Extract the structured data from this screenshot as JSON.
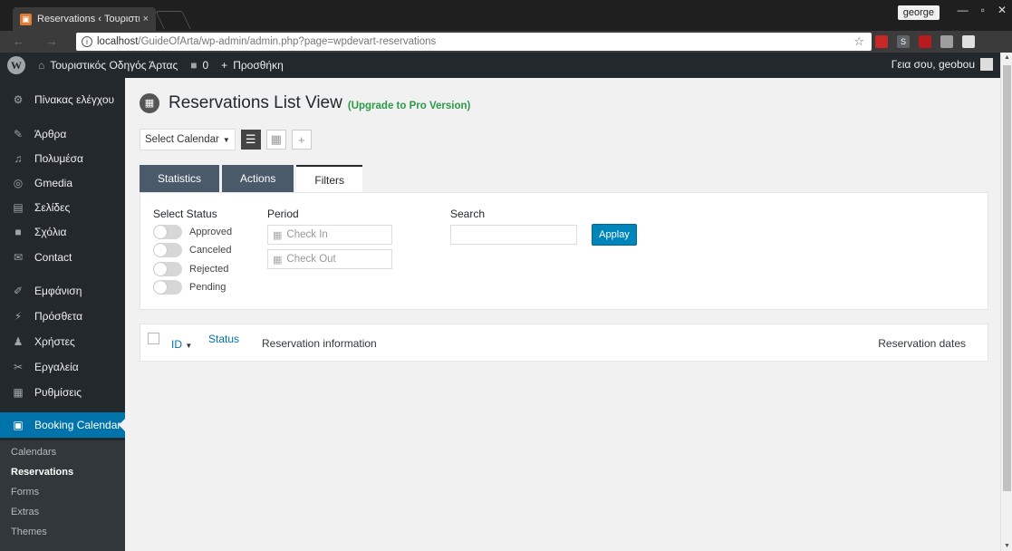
{
  "browser": {
    "tab_title": "Reservations ‹ Τουριστικ",
    "tab_close": "×",
    "profile_name": "george",
    "window_controls": [
      "—",
      "▫",
      "✕"
    ],
    "nav_buttons": "← → C",
    "url_host": "localhost",
    "url_path": "/GuideOfArta/wp-admin/admin.php?page=wpdevart-reservations",
    "info_icon": "i",
    "bookmark_star": "☆",
    "extensions": [
      {
        "name": "ext-red-icon",
        "label": "",
        "color": "#c62828"
      },
      {
        "name": "ext-s-icon",
        "label": "S",
        "color": "#5f6368"
      },
      {
        "name": "ext-ublock-icon",
        "label": "",
        "color": "#b71c1c"
      },
      {
        "name": "ext-puzzle-icon",
        "label": "",
        "color": "#9e9e9e"
      },
      {
        "name": "ext-drive-icon",
        "label": "",
        "color": "#e0e0e0"
      }
    ]
  },
  "adminbar": {
    "wp_logo": "W",
    "site_name": "Τουριστικός Οδηγός Άρτας",
    "comments_count": "0",
    "new_label": "Προσθήκη",
    "greeting": "Γεια σου, geobou"
  },
  "sidebar": {
    "items": [
      {
        "label": "Πίνακας ελέγχου",
        "icon": "dashboard-icon",
        "glyph": "⚙"
      },
      {
        "label": "Άρθρα",
        "icon": "pin-icon",
        "glyph": "✎"
      },
      {
        "label": "Πολυμέσα",
        "icon": "media-icon",
        "glyph": "♫"
      },
      {
        "label": "Gmedia",
        "icon": "gmedia-icon",
        "glyph": "◎"
      },
      {
        "label": "Σελίδες",
        "icon": "pages-icon",
        "glyph": "▤"
      },
      {
        "label": "Σχόλια",
        "icon": "comments-icon",
        "glyph": "■"
      },
      {
        "label": "Contact",
        "icon": "mail-icon",
        "glyph": "✉"
      },
      {
        "label": "Εμφάνιση",
        "icon": "appearance-icon",
        "glyph": "✐"
      },
      {
        "label": "Πρόσθετα",
        "icon": "plugins-icon",
        "glyph": "⚡"
      },
      {
        "label": "Χρήστες",
        "icon": "users-icon",
        "glyph": "♟"
      },
      {
        "label": "Εργαλεία",
        "icon": "tools-icon",
        "glyph": "✂"
      },
      {
        "label": "Ρυθμίσεις",
        "icon": "settings-icon",
        "glyph": "▦"
      },
      {
        "label": "Booking Calendar",
        "icon": "calendar-icon",
        "glyph": "▣"
      }
    ],
    "submenu": [
      "Calendars",
      "Reservations",
      "Forms",
      "Extras",
      "Themes"
    ]
  },
  "page": {
    "title": "Reservations List View",
    "upgrade_link": "(Upgrade to Pro Version)",
    "select_calendar": "Select Calendar",
    "tabs": [
      "Statistics",
      "Actions",
      "Filters"
    ],
    "filters": {
      "status_label": "Select Status",
      "statuses": [
        "Approved",
        "Canceled",
        "Rejected",
        "Pending"
      ],
      "period_label": "Period",
      "check_in_placeholder": "Check In",
      "check_out_placeholder": "Check Out",
      "search_label": "Search",
      "search_value": "",
      "apply_label": "Applay"
    },
    "table": {
      "col_id": "ID",
      "col_status": "Status",
      "col_info": "Reservation information",
      "col_dates": "Reservation dates"
    }
  }
}
